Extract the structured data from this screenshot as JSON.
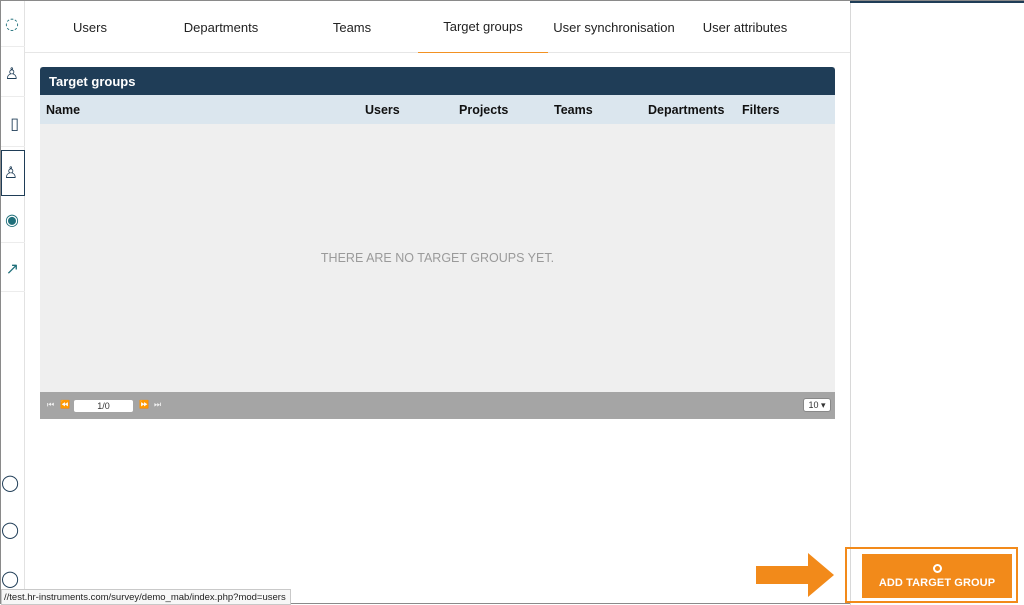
{
  "tabs": [
    {
      "label": "Users"
    },
    {
      "label": "Departments"
    },
    {
      "label": "Teams"
    },
    {
      "label": "Target groups",
      "active": true
    },
    {
      "label": "User synchronisation"
    },
    {
      "label": "User attributes"
    }
  ],
  "rail": {
    "items": [
      {
        "icon": "chat-icon"
      },
      {
        "icon": "user-icon"
      },
      {
        "icon": "document-icon"
      },
      {
        "icon": "user-group-icon",
        "active": true
      },
      {
        "icon": "eye-icon"
      },
      {
        "icon": "chart-icon"
      }
    ],
    "bottom_items": [
      {
        "icon": "help-icon"
      },
      {
        "icon": "settings-icon"
      },
      {
        "icon": "power-icon"
      }
    ]
  },
  "panel": {
    "title": "Target groups",
    "columns": [
      "Name",
      "Users",
      "Projects",
      "Teams",
      "Departments",
      "Filters"
    ],
    "empty_message": "THERE ARE NO TARGET GROUPS YET."
  },
  "pager": {
    "page_value": "1/0",
    "page_size": "10 ▾"
  },
  "status_bar": {
    "url": "//test.hr-instruments.com/survey/demo_mab/index.php?mod=users"
  },
  "action": {
    "add_label": "ADD TARGET GROUP"
  },
  "colors": {
    "header": "#1f3d57",
    "accent": "#f28a1a",
    "column_header": "#dbe6ee"
  }
}
